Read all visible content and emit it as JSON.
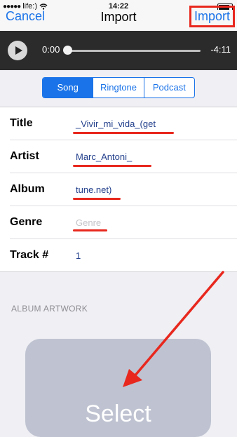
{
  "status_bar": {
    "carrier": "life:)",
    "time": "14:22"
  },
  "nav": {
    "cancel": "Cancel",
    "title": "Import",
    "import": "Import"
  },
  "player": {
    "elapsed": "0:00",
    "remaining": "-4:11",
    "progress": 0.0
  },
  "segmented": {
    "options": [
      "Song",
      "Ringtone",
      "Podcast"
    ],
    "selected": "Song"
  },
  "fields": [
    {
      "label": "Title",
      "value": "_Vivir_mi_vida_(get"
    },
    {
      "label": "Artist",
      "value": "Marc_Antoni_"
    },
    {
      "label": "Album",
      "value": "tune.net)"
    },
    {
      "label": "Genre",
      "value": "Genre"
    },
    {
      "label": "Track #",
      "value": "1"
    }
  ],
  "artwork": {
    "section_title": "ALBUM ARTWORK",
    "button": "Select"
  },
  "annotation_color": "#e8281e"
}
